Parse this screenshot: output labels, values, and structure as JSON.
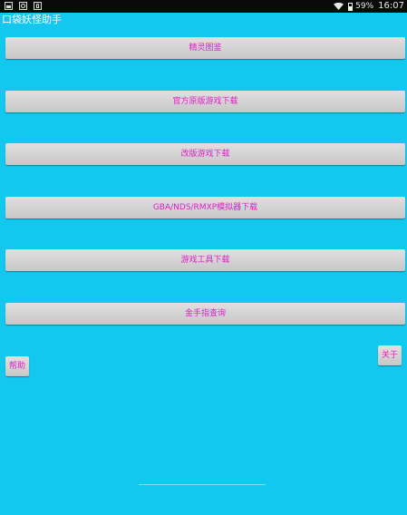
{
  "status_bar": {
    "battery_percent": "59%",
    "time": "16:07",
    "icons": {
      "notification_1": "image-icon",
      "notification_2": "photo-icon",
      "notification_3": "bag-icon",
      "wifi": "wifi-icon",
      "battery": "battery-icon"
    }
  },
  "app": {
    "title": "口袋妖怪助手"
  },
  "menu": {
    "buttons": [
      {
        "label": "精灵图鉴"
      },
      {
        "label": "官方原版游戏下载"
      },
      {
        "label": "改版游戏下载"
      },
      {
        "label": "GBA/NDS/RMXP模拟器下载"
      },
      {
        "label": "游戏工具下载"
      },
      {
        "label": "金手指查询"
      }
    ]
  },
  "footer": {
    "help_label": "帮助",
    "about_label": "关于"
  },
  "colors": {
    "background": "#13c8ee",
    "button_text": "#e01ec8",
    "button_face": "#d4d5d3"
  }
}
